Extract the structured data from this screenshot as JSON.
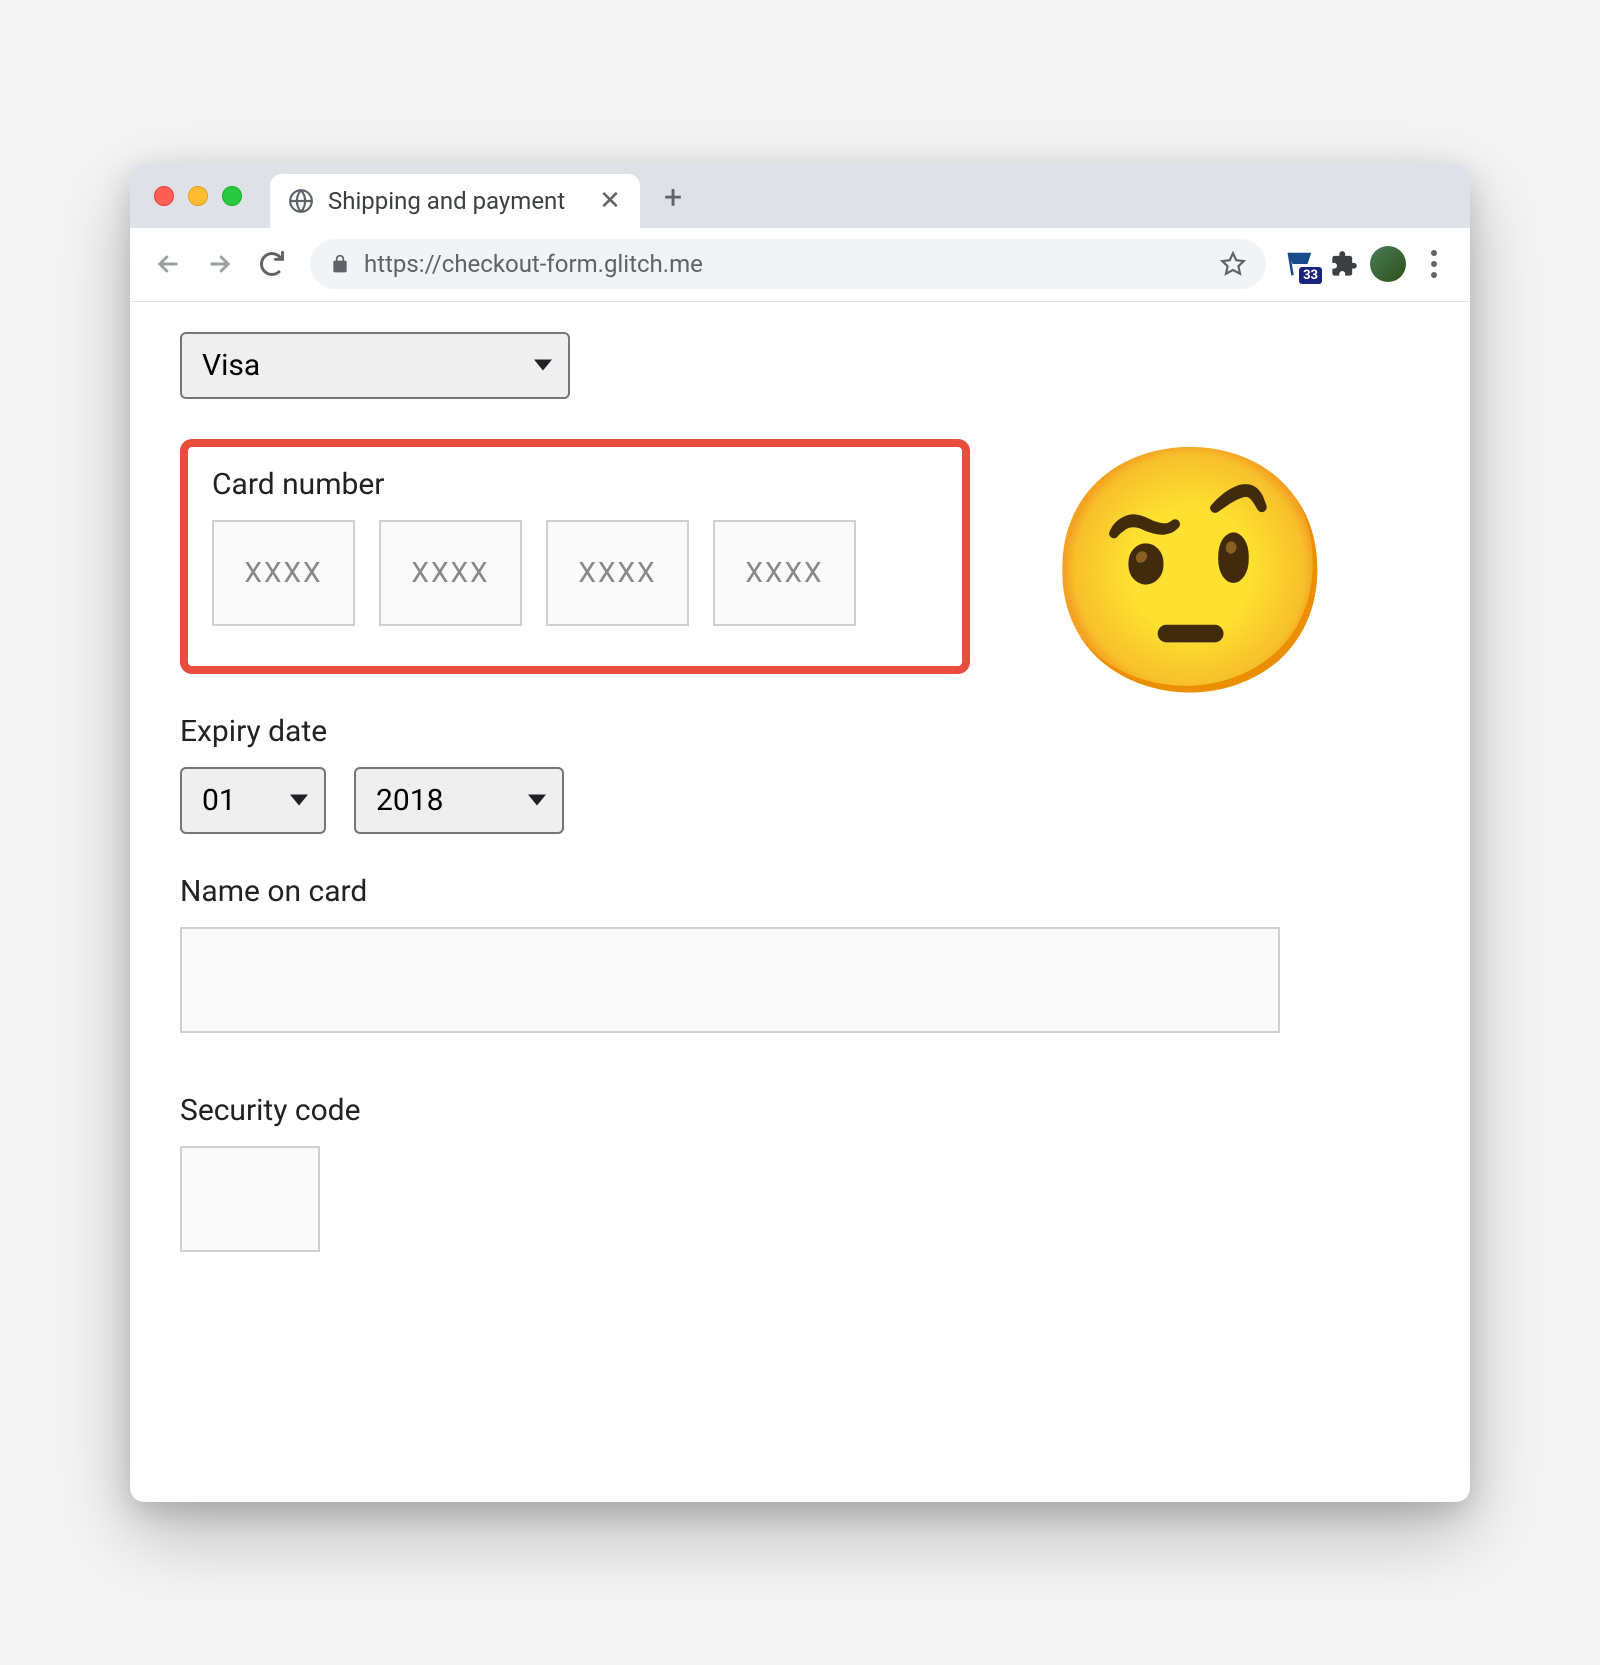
{
  "browser": {
    "tab_title": "Shipping and payment",
    "url": "https://checkout-form.glitch.me",
    "extension_badge": "33"
  },
  "form": {
    "card_type": {
      "selected": "Visa"
    },
    "card_number": {
      "label": "Card number",
      "placeholder": "XXXX"
    },
    "expiry": {
      "label": "Expiry date",
      "month": "01",
      "year": "2018"
    },
    "name": {
      "label": "Name on card",
      "value": ""
    },
    "cvv": {
      "label": "Security code",
      "value": ""
    }
  },
  "emoji": "🤨"
}
